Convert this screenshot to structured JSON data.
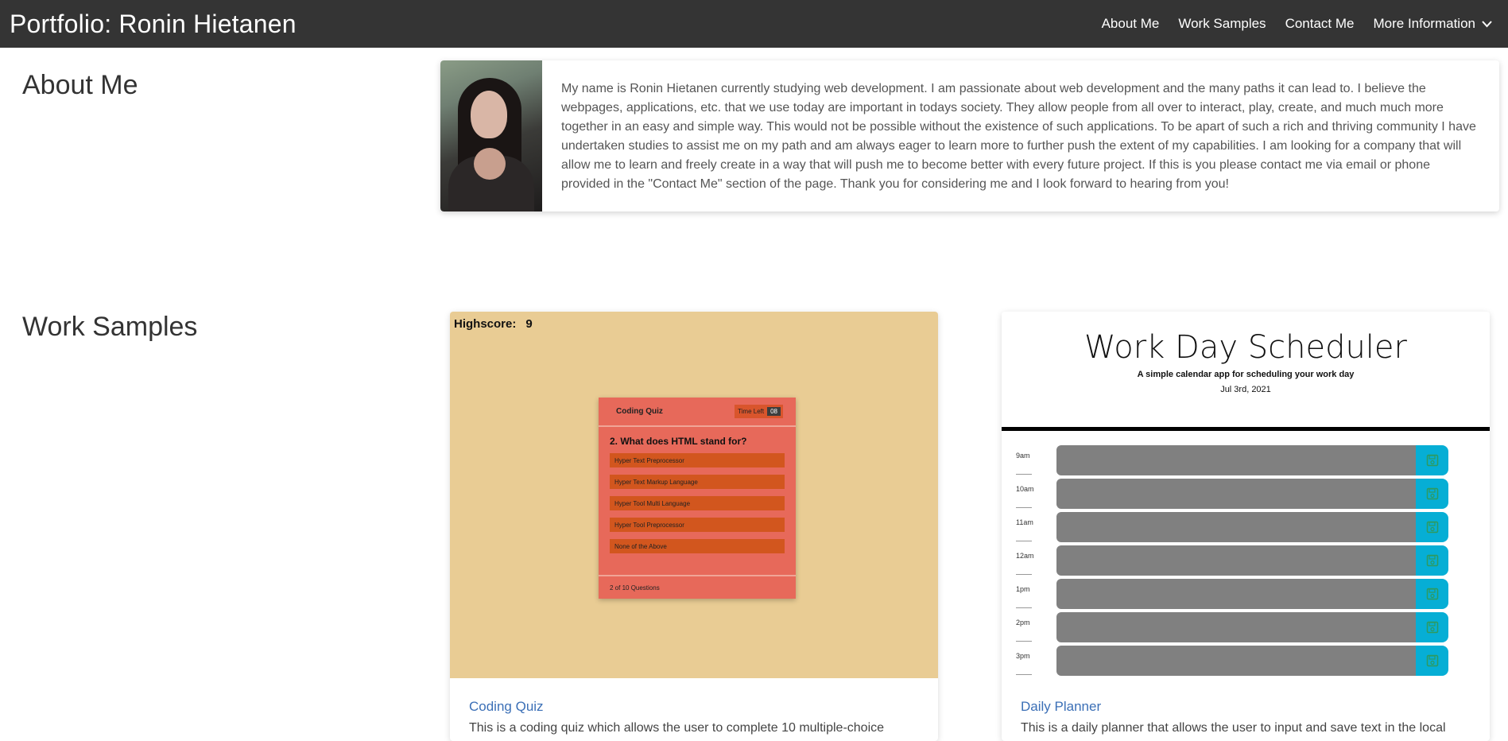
{
  "navbar": {
    "brand": "Portfolio: Ronin Hietanen",
    "links": [
      "About Me",
      "Work Samples",
      "Contact Me"
    ],
    "dropdown_label": "More Information"
  },
  "about": {
    "title": "About Me",
    "text": "My name is Ronin Hietanen currently studying web development. I am passionate about web development and the many paths it can lead to. I believe the webpages, applications, etc. that we use today are important in todays society. They allow people from all over to interact, play, create, and much much more together in an easy and simple way. This would not be possible without the existence of such applications. To be apart of such a rich and thriving community I have undertaken studies to assist me on my path and am always eager to learn more to further push the extent of my capabilities. I am looking for a company that will allow me to learn and freely create in a way that will push me to become better with every future project. If this is you please contact me via email or phone provided in the \"Contact Me\" section of the page. Thank you for considering me and I look forward to hearing from you!"
  },
  "work": {
    "title": "Work Samples",
    "projects": [
      {
        "name": "Coding Quiz",
        "description": "This is a coding quiz which allows the user to complete 10 multiple-choice"
      },
      {
        "name": "Daily Planner",
        "description": "This is a daily planner that allows the user to input and save text in the local"
      }
    ]
  },
  "quiz_screenshot": {
    "highscore_label": "Highscore:",
    "highscore_value": "9",
    "title": "Coding Quiz",
    "time_label": "Time Left",
    "time_value": "08",
    "question": "2. What does HTML stand for?",
    "options": [
      "Hyper Text Preprocessor",
      "Hyper Text Markup Language",
      "Hyper Tool Multi Language",
      "Hyper Tool Preprocessor",
      "None of the Above"
    ],
    "progress": "2 of 10 Questions"
  },
  "planner_screenshot": {
    "title": "Work Day Scheduler",
    "subtitle": "A simple calendar app for scheduling your work day",
    "date": "Jul 3rd, 2021",
    "hours": [
      "9am",
      "10am",
      "11am",
      "12am",
      "1pm",
      "2pm",
      "3pm"
    ]
  },
  "colors": {
    "navbar": "#343434",
    "quiz_bg": "#e9cc94",
    "quiz_box": "#e7695a",
    "save_button": "#06aed5",
    "link": "#3b6fb6"
  }
}
